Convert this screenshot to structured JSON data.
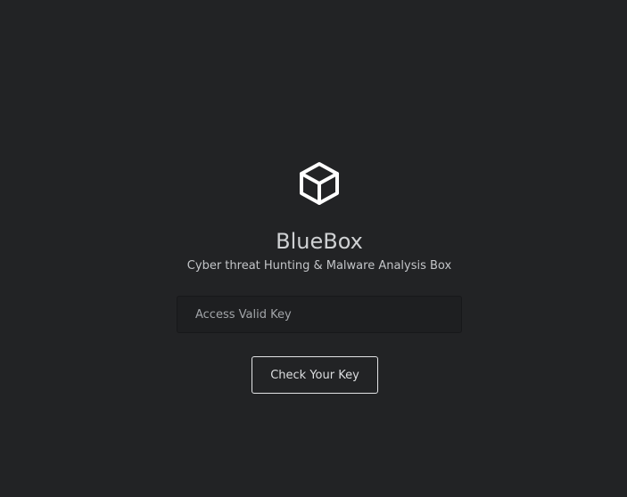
{
  "app": {
    "logo_icon": "cube-icon",
    "title": "BlueBox",
    "subtitle": "Cyber threat Hunting & Malware Analysis Box"
  },
  "form": {
    "key_input": {
      "placeholder": "Access Valid Key",
      "value": ""
    },
    "submit_label": "Check Your Key"
  },
  "colors": {
    "background": "#222325",
    "text": "#cfd1d3",
    "button_border": "#e3e4e6"
  }
}
